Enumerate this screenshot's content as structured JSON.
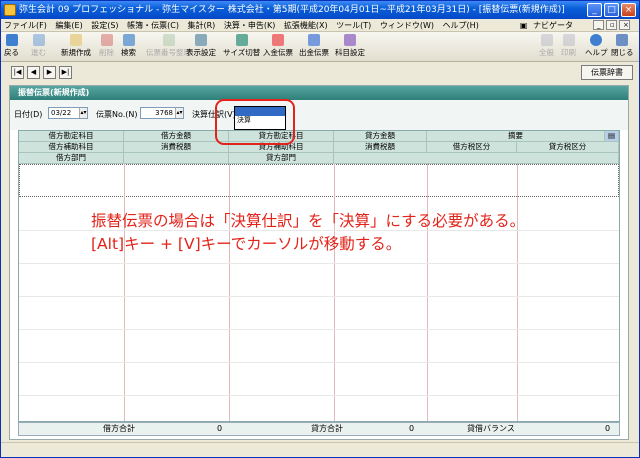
{
  "window": {
    "title": "弥生会計 09 プロフェッショナル - 弥生マイスター 株式会社・第5期(平成20年04月01日~平成21年03月31日) - [振替伝票(新規作成)]",
    "min": "_",
    "max": "□",
    "close": "×"
  },
  "menu": {
    "items": [
      "ファイル(F)",
      "編集(E)",
      "設定(S)",
      "帳簿・伝票(C)",
      "集計(R)",
      "決算・申告(K)",
      "拡張機能(X)",
      "ツール(T)",
      "ウィンドウ(W)",
      "ヘルプ(H)"
    ],
    "navi": "ナビゲータ"
  },
  "toolbar": {
    "left": [
      "戻る",
      "進む",
      "新規作成",
      "削除",
      "検索",
      "伝票番号整理",
      "表示設定",
      "サイズ切替",
      "入金伝票",
      "出金伝票",
      "科目設定"
    ],
    "right": [
      "全般",
      "印刷",
      "ヘルプ",
      "閉じる"
    ]
  },
  "nav": {
    "first": "|◀",
    "prev": "◀",
    "next": "▶",
    "last": "▶|",
    "dict": "伝票辞書"
  },
  "form": {
    "header": "振替伝票(新規作成)",
    "date_label": "日付(D)",
    "date_value": "03/22",
    "no_label": "伝票No.(N)",
    "no_value": "3768",
    "kessan_label": "決算仕訳(V)",
    "kessan_value": "",
    "options": [
      "",
      "決算"
    ]
  },
  "grid": {
    "headers_row1": [
      "借方勘定科目",
      "借方金額",
      "貸方勘定科目",
      "貸方金額",
      "摘要"
    ],
    "headers_row2": [
      "借方補助科目",
      "消費税額",
      "貸方補助科目",
      "消費税額",
      "借方税区分",
      "貸方税区分"
    ],
    "headers_row3": [
      "借方部門",
      "貸方部門"
    ]
  },
  "overlay": {
    "line1": "振替伝票の場合は「決算仕訳」を「決算」にする必要がある。",
    "line2": "[Alt]キー + [V]キーでカーソルが移動する。"
  },
  "totals": {
    "debit_label": "借方合計",
    "debit_value": "0",
    "credit_label": "貸方合計",
    "credit_value": "0",
    "balance_label": "貸借バランス",
    "balance_value": "0"
  },
  "colors": {
    "titlebar": "#0a5fd8",
    "form_header": "#2f7f79",
    "grid_header": "#cfe3dd",
    "highlight": "#e2231a"
  }
}
